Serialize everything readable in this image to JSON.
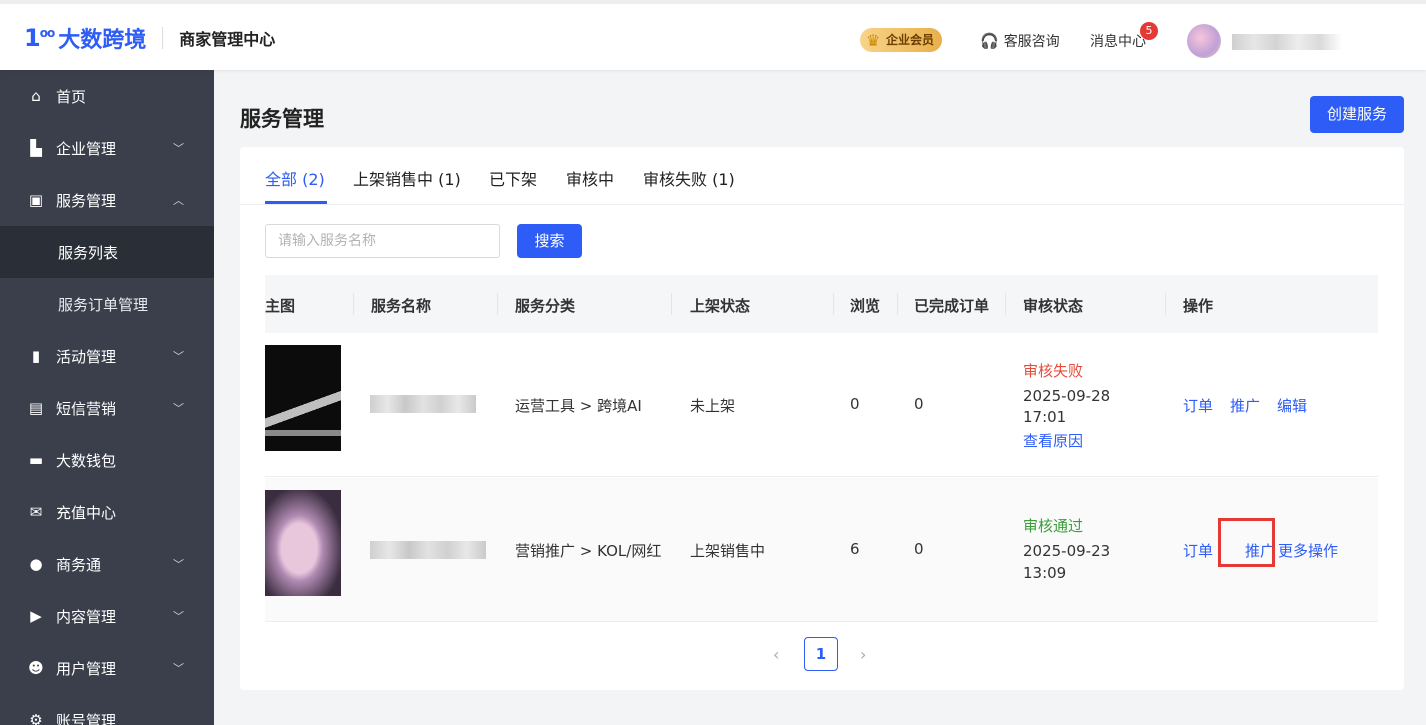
{
  "header": {
    "logo_mark": "1",
    "logo_mark_sup": "oo",
    "logo_text": "大数跨境",
    "subtitle": "商家管理中心",
    "vip_label": "企业会员",
    "support_label": "客服咨询",
    "messages_label": "消息中心",
    "messages_count": "5"
  },
  "sidebar": {
    "items": [
      {
        "label": "首页",
        "icon": "home-icon"
      },
      {
        "label": "企业管理",
        "icon": "building-icon"
      },
      {
        "label": "服务管理",
        "icon": "briefcase-icon"
      },
      {
        "label": "服务列表"
      },
      {
        "label": "服务订单管理"
      },
      {
        "label": "活动管理",
        "icon": "bookmark-icon"
      },
      {
        "label": "短信营销",
        "icon": "sms-icon"
      },
      {
        "label": "大数钱包",
        "icon": "wallet-icon"
      },
      {
        "label": "充值中心",
        "icon": "recharge-icon"
      },
      {
        "label": "商务通",
        "icon": "chat-icon"
      },
      {
        "label": "内容管理",
        "icon": "document-icon"
      },
      {
        "label": "用户管理",
        "icon": "users-icon"
      },
      {
        "label": "账号管理",
        "icon": "gear-icon"
      }
    ]
  },
  "main": {
    "title": "服务管理",
    "create_button": "创建服务",
    "tabs": [
      {
        "label": "全部 (2)"
      },
      {
        "label": "上架销售中 (1)"
      },
      {
        "label": "已下架"
      },
      {
        "label": "审核中"
      },
      {
        "label": "审核失败 (1)"
      }
    ],
    "search": {
      "placeholder": "请输入服务名称",
      "value": "",
      "button": "搜索"
    },
    "table": {
      "columns": [
        "主图",
        "服务名称",
        "服务分类",
        "上架状态",
        "浏览",
        "已完成订单",
        "审核状态",
        "操作"
      ],
      "rows": [
        {
          "category": "运营工具 > 跨境AI",
          "listing_status": "未上架",
          "views": "0",
          "orders": "0",
          "review_status": "审核失败",
          "review_date": "2025-09-28",
          "review_time": "17:01",
          "review_link": "查看原因",
          "actions": [
            "订单",
            "推广",
            "编辑"
          ]
        },
        {
          "category": "营销推广 > KOL/网红",
          "listing_status": "上架销售中",
          "views": "6",
          "orders": "0",
          "review_status": "审核通过",
          "review_date": "2025-09-23",
          "review_time": "13:09",
          "actions": [
            "订单",
            "推广",
            "更多操作"
          ]
        }
      ]
    },
    "pagination": {
      "prev": "‹",
      "current": "1",
      "next": "›"
    }
  },
  "colors": {
    "primary": "#2d5cf6",
    "sidebar_bg": "#3a3f4b",
    "fail": "#e74c3c",
    "pass": "#3a9d3a",
    "highlight": "#e53935"
  }
}
